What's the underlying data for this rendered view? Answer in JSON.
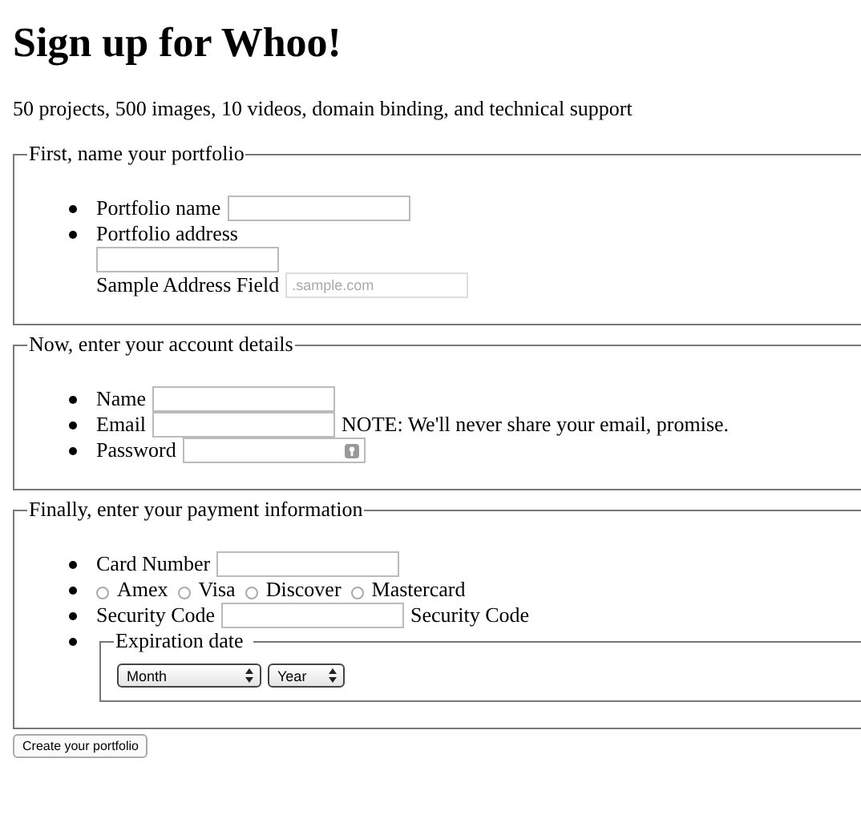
{
  "title": "Sign up for Whoo!",
  "intro": "50 projects, 500 images, 10 videos, domain binding, and technical support",
  "sections": [
    {
      "legend": "First, name your portfolio",
      "items": [
        {
          "kind": "field",
          "label": "Portfolio name"
        },
        {
          "kind": "address",
          "label": "Portfolio address",
          "sub_label": "Sample Address Field",
          "placeholder": ".sample.com"
        }
      ]
    },
    {
      "legend": "Now, enter your account details",
      "items": [
        {
          "kind": "field",
          "label": "Name"
        },
        {
          "kind": "field",
          "label": "Email",
          "note": "NOTE: We'll never share your email, promise."
        },
        {
          "kind": "password",
          "label": "Password"
        }
      ]
    },
    {
      "legend": "Finally, enter your payment information",
      "items": [
        {
          "kind": "field",
          "label": "Card Number"
        },
        {
          "kind": "radios",
          "options": [
            {
              "label": "Amex",
              "selected": false
            },
            {
              "label": "Visa",
              "selected": false
            },
            {
              "label": "Discover",
              "selected": false
            },
            {
              "label": "Mastercard",
              "selected": false
            }
          ]
        },
        {
          "kind": "field",
          "label": "Security Code",
          "note": "Security Code"
        },
        {
          "kind": "group",
          "legend": "Expiration date",
          "selects": [
            {
              "value": "Month"
            },
            {
              "value": "Year"
            }
          ]
        }
      ]
    }
  ],
  "submit": "Create your portfolio"
}
